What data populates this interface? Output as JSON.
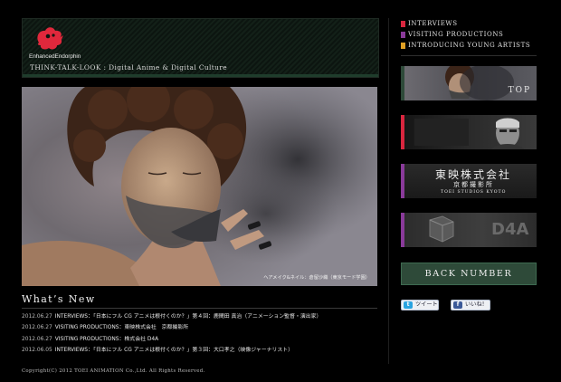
{
  "header": {
    "brand": "EnhancedEndorphin",
    "tagline": "THINK-TALK-LOOK : Digital Anime & Digital Culture",
    "logo_color": "#e0283c"
  },
  "hero": {
    "caption": "ヘアメイク&ネイル：倉留沙織（東京モード学園）"
  },
  "news": {
    "title": "What’s New",
    "items": [
      {
        "date": "2012.06.27",
        "text": "INTERVIEWS：「日本にフル CG アニメは根付くのか？」第４回：鹿間田 真治（アニメーション監督・演出家）"
      },
      {
        "date": "2012.06.27",
        "text": "VISITING PRODUCTIONS：東映株式会社　京都撮影所"
      },
      {
        "date": "2012.06.27",
        "text": "VISITING PRODUCTIONS：株式会社 D4A"
      },
      {
        "date": "2012.06.05",
        "text": "INTERVIEWS：「日本にフル CG アニメは根付くのか？」第３回：大口孝之（映像ジャーナリスト）"
      }
    ]
  },
  "footer": {
    "copyright": "Copyright(C) 2012 TOEI ANIMATION Co.,Ltd. All Rights Reserved."
  },
  "nav": {
    "items": [
      {
        "label": "INTERVIEWS",
        "color": "#d9263f"
      },
      {
        "label": "VISITING PRODUCTIONS",
        "color": "#8a3a9a"
      },
      {
        "label": "INTRODUCING YOUNG ARTISTS",
        "color": "#e0a024"
      }
    ]
  },
  "banners": {
    "top": {
      "label": "TOP",
      "accent": "#2e4a39"
    },
    "interview": {
      "accent": "#d9263f"
    },
    "toei": {
      "title": "東映株式会社",
      "subtitle": "京都撮影所",
      "small": "TOEI STUDIOS KYOTO",
      "accent": "#8a3a9a"
    },
    "d4a": {
      "label": "D4A",
      "accent": "#8a3a9a"
    }
  },
  "back_number": {
    "label": "BACK NUMBER",
    "color": "#2e4a39"
  },
  "social": {
    "tweet": {
      "label": "ツイート",
      "icon": "twitter-icon"
    },
    "like": {
      "label": "いいね！",
      "icon": "facebook-icon"
    }
  }
}
